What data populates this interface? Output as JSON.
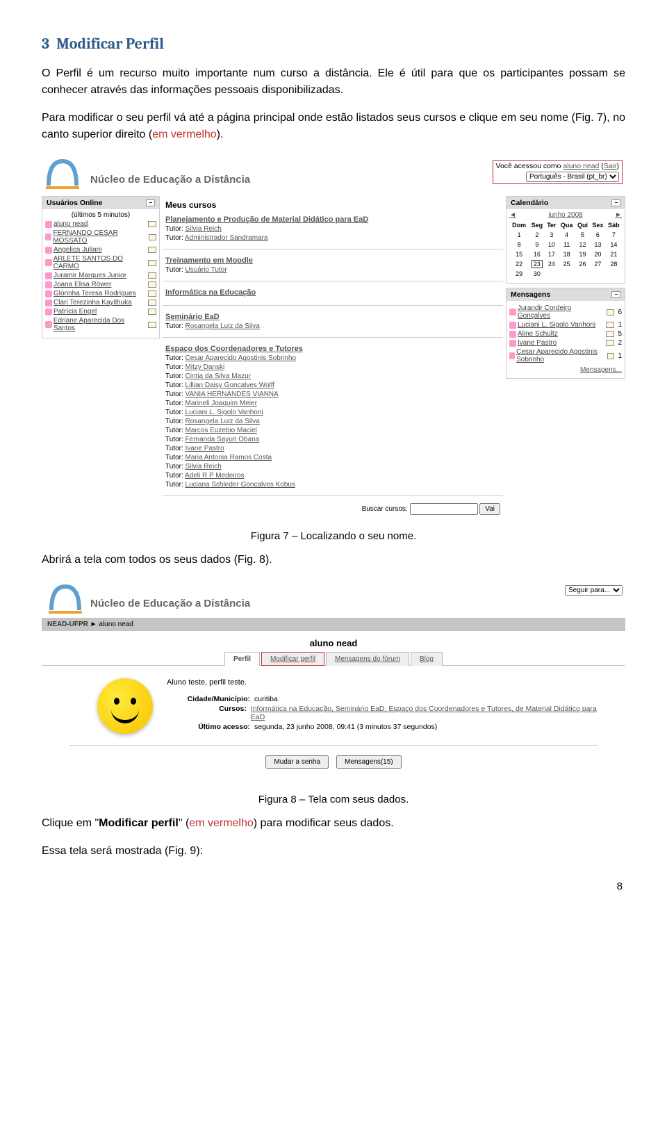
{
  "heading": {
    "num": "3",
    "text": "Modificar Perfil"
  },
  "para1": "O Perfil é um recurso muito importante num curso a distância. Ele é útil para que os participantes possam se conhecer através das informações pessoais disponibilizadas.",
  "para2": "Para modificar o seu perfil vá até a página principal onde estão listados seus cursos e clique em seu nome (Fig. 7), no canto superior direito (",
  "para2_em": "em vermelho",
  "para2_end": ").",
  "moodle": {
    "nead_title": "Núcleo de Educação a Distância",
    "login_prefix": "Você acessou como ",
    "login_user": "aluno nead",
    "login_logout": "Sair",
    "lang_select": "Português - Brasil (pt_br)",
    "users_block_title": "Usuários Online",
    "users_subtitle": "(últimos 5 minutos)",
    "users": [
      "aluno nead",
      "FERNANDO CESAR MOSSATO",
      "Angelica Juliani",
      "ARLETE SANTOS DO CARMO",
      "Juramir Marques Junior",
      "Joana Elisa Röwer",
      "Glorinha Teresa Rodrigues",
      "Clari Terezinha Kayilhuka",
      "Patrícia Engel",
      "Edriane Aparecida Dos Santos"
    ],
    "courses_header": "Meus cursos",
    "courses": [
      {
        "name": "Planejamento e Produção de Material Didático para EaD",
        "tutors": [
          "Silvia Reich",
          "Administrador Sandramara"
        ]
      },
      {
        "name": "Treinamento em Moodle",
        "tutors": [
          "Usuário Tutor"
        ]
      },
      {
        "name": "Informática na Educação",
        "tutors": []
      },
      {
        "name": "Seminário EaD",
        "tutors": [
          "Rosangela Luiz da Silva"
        ]
      },
      {
        "name": "Espaço dos Coordenadores e Tutores",
        "tutors": [
          "Cesar Aparecido Agostinis Sobrinho",
          "Mitzy Danski",
          "Cintia da Silva Mazur",
          "Lillian Daisy Goncalves Wolff",
          "VANIA HERNANDES VIANNA",
          "Marineli Joaquim Meier",
          "Luciani L. Sigolo Vanhoni",
          "Rosangela Luiz da Silva",
          "Marcos Euzebio Maciel",
          "Fernanda Sayuri Obana",
          "Ivane Pastro",
          "Maria Antonia Ramos Costa",
          "Silvia Reich",
          "Adeli R P Medeiros",
          "Luciana Schleder Goncalves Kobus"
        ]
      }
    ],
    "tutor_label": "Tutor:",
    "search_label": "Buscar cursos:",
    "search_btn": "Vai",
    "calendar_title": "Calendário",
    "calendar_month": "junho 2008",
    "cal_days": [
      "Dom",
      "Seg",
      "Ter",
      "Qua",
      "Qui",
      "Sex",
      "Sáb"
    ],
    "cal_rows": [
      [
        "1",
        "2",
        "3",
        "4",
        "5",
        "6",
        "7"
      ],
      [
        "8",
        "9",
        "10",
        "11",
        "12",
        "13",
        "14"
      ],
      [
        "15",
        "16",
        "17",
        "18",
        "19",
        "20",
        "21"
      ],
      [
        "22",
        "23",
        "24",
        "25",
        "26",
        "27",
        "28"
      ],
      [
        "29",
        "30",
        "",
        "",
        "",
        "",
        ""
      ]
    ],
    "cal_selected": "23",
    "messages_title": "Mensagens",
    "messages": [
      {
        "name": "Jurandir Cordeiro Gonçalves",
        "count": "6"
      },
      {
        "name": "Luciani L. Sigolo Vanhoni",
        "count": "1"
      },
      {
        "name": "Aline Schultz",
        "count": "5"
      },
      {
        "name": "Ivane Pastro",
        "count": "2"
      },
      {
        "name": "Cesar Aparecido Agostinis Sobrinho",
        "count": "1"
      }
    ],
    "messages_link": "Mensagens..."
  },
  "caption1": "Figura 7 – Localizando o seu nome.",
  "para3": "Abrirá a tela com todos os seus dados (Fig. 8).",
  "profile": {
    "jump_label": "Seguir para...",
    "breadcrumb_root": "NEAD-UFPR",
    "breadcrumb_sep": "►",
    "breadcrumb_user": "aluno nead",
    "title": "aluno nead",
    "tabs": [
      "Perfil",
      "Modificar perfil",
      "Mensagens do fórum",
      "Blog"
    ],
    "desc": "Aluno teste, perfil teste.",
    "city_label": "Cidade/Município:",
    "city": "curitiba",
    "courses_label": "Cursos:",
    "courses_text": "Informática na Educação, Seminário EaD, Espaço dos Coordenadores e Tutores, de Material Didático para EaD",
    "access_label": "Último acesso:",
    "access_text": "segunda, 23 junho 2008, 09:41 (3 minutos 37 segundos)",
    "btn_pwd": "Mudar a senha",
    "btn_msgs": "Mensagens(15)"
  },
  "caption2": "Figura 8 – Tela com seus dados.",
  "para4_a": "Clique em \"",
  "para4_bold": "Modificar perfil",
  "para4_b": "\" (",
  "para4_em": "em vermelho",
  "para4_c": ") para modificar seus dados.",
  "para5": "Essa tela será mostrada (Fig. 9):",
  "page_number": "8"
}
